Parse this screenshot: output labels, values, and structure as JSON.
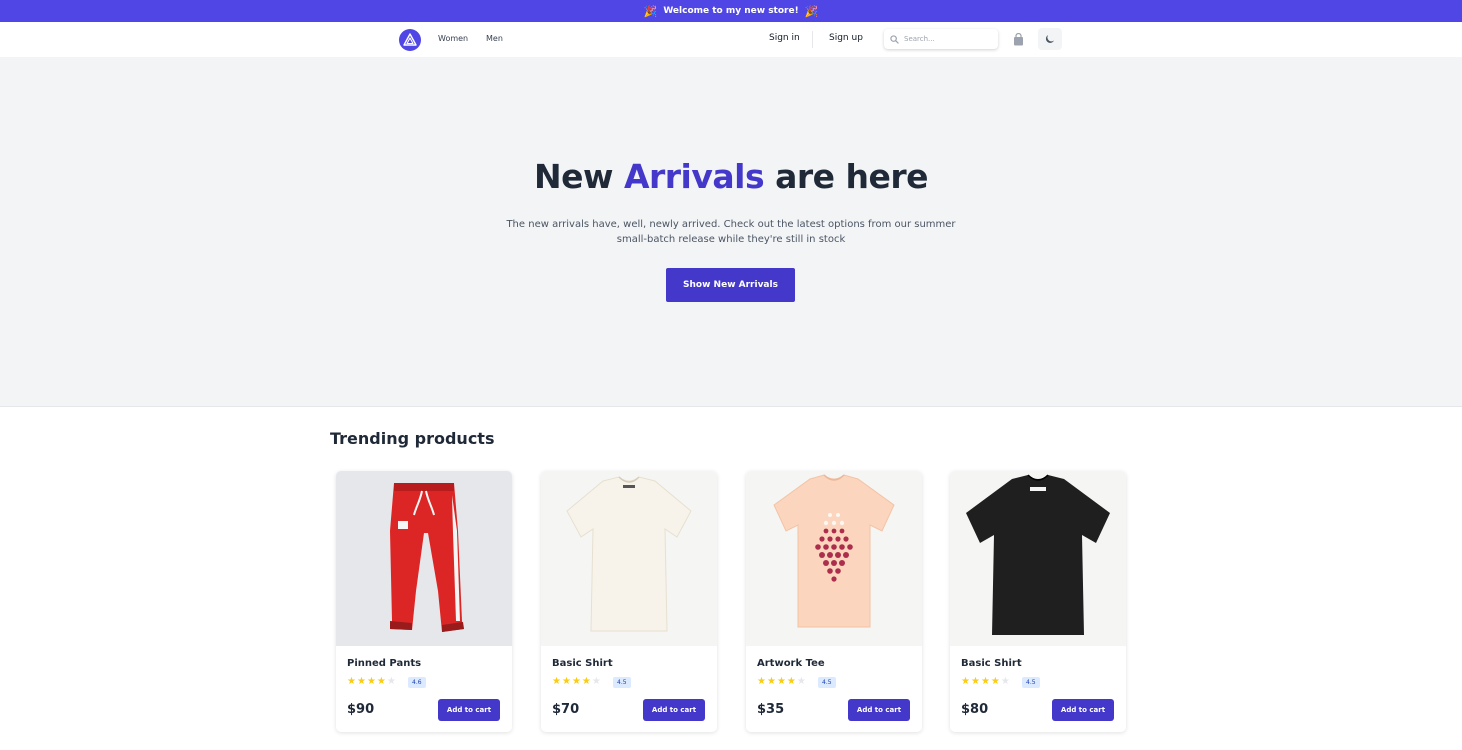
{
  "announcement": {
    "text": "Welcome to my new store!",
    "emoji": "🎉"
  },
  "nav": {
    "links": [
      "Women",
      "Men"
    ],
    "sign_in": "Sign in",
    "sign_up": "Sign up",
    "search_placeholder": "Search..."
  },
  "hero": {
    "title_pre": "New",
    "title_accent": "Arrivals",
    "title_post": "are here",
    "description": "The new arrivals have, well, newly arrived. Check out the latest options from our summer small-batch release while they're still in stock",
    "cta_label": "Show New Arrivals"
  },
  "trending": {
    "title": "Trending products",
    "products": [
      {
        "name": "Pinned Pants",
        "rating": "4.6",
        "stars_filled": 4,
        "price": "$90",
        "add_label": "Add to cart"
      },
      {
        "name": "Basic Shirt",
        "rating": "4.5",
        "stars_filled": 4,
        "price": "$70",
        "add_label": "Add to cart"
      },
      {
        "name": "Artwork Tee",
        "rating": "4.5",
        "stars_filled": 4,
        "price": "$35",
        "add_label": "Add to cart"
      },
      {
        "name": "Basic Shirt",
        "rating": "4.5",
        "stars_filled": 4,
        "price": "$80",
        "add_label": "Add to cart"
      }
    ]
  },
  "colors": {
    "brand": "#4f46e5",
    "accent": "#4338ca",
    "hero_bg": "#f3f4f6",
    "star": "#facc15"
  }
}
